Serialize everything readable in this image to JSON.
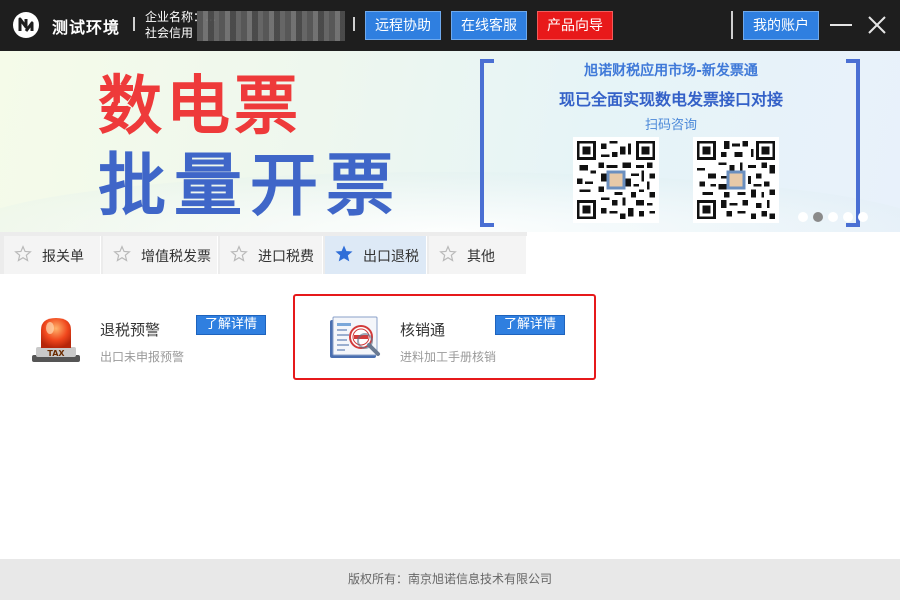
{
  "header": {
    "app_title": "测试环境",
    "company_line1": "企业名称：...",
    "company_line2": "社会信用",
    "buttons": {
      "remote": "远程协助",
      "service": "在线客服",
      "guide": "产品向导",
      "account": "我的账户"
    }
  },
  "banner": {
    "headline1": "数电票",
    "headline2": "批量开票",
    "right_title": "旭诺财税应用市场-新发票通",
    "right_subtitle": "现已全面实现数电发票接口对接",
    "right_caption": "扫码咨询",
    "slides": 5,
    "active_slide": 2
  },
  "tabs": [
    {
      "label": "报关单",
      "active": false,
      "star": "star-outline-icon"
    },
    {
      "label": "增值税发票",
      "active": false,
      "star": "star-outline-icon"
    },
    {
      "label": "进口税费",
      "active": false,
      "star": "star-outline-icon"
    },
    {
      "label": "出口退税",
      "active": true,
      "star": "star-filled-icon"
    },
    {
      "label": "其他",
      "active": false,
      "star": "star-outline-icon"
    }
  ],
  "products": [
    {
      "title": "退税预警",
      "desc": "出口未申报预警",
      "button": "了解详情",
      "icon": "tax-alarm-light-icon",
      "icon_text": "TAX"
    },
    {
      "title": "核销通",
      "desc": "进料加工手册核销",
      "button": "了解详情",
      "icon": "verification-document-icon"
    }
  ],
  "footer": {
    "copyright": "版权所有：南京旭诺信息技术有限公司"
  },
  "colors": {
    "titlebar": "#1e1e1e",
    "primary_button": "#2f7fe0",
    "red_button": "#e8191a",
    "headline_red": "#ee3a3a",
    "headline_blue": "#3f66c8",
    "highlight": "#e6191b"
  }
}
